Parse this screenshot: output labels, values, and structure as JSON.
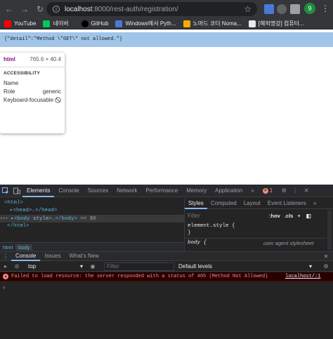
{
  "browser": {
    "url_host": "localhost",
    "url_rest": ":8000/rest-auth/registration/",
    "profile_initial": "9",
    "bookmarks": [
      "YouTube",
      "네이버",
      "GitHub",
      "Windows에서 Pyth...",
      "노마드 코더 Noma...",
      "[해외명강] 컴퓨터..."
    ]
  },
  "page": {
    "body_text": "{\"detail\":\"Method \\\"GET\\\" not allowed.\"}"
  },
  "tooltip": {
    "tag": "html",
    "size": "765.6 × 40.4",
    "heading": "ACCESSIBILITY",
    "rows": [
      {
        "label": "Name",
        "value": ""
      },
      {
        "label": "Role",
        "value": "generic"
      },
      {
        "label": "Keyboard-focusable",
        "value": ""
      }
    ]
  },
  "devtools": {
    "tabs": [
      "Elements",
      "Console",
      "Sources",
      "Network",
      "Performance",
      "Memory",
      "Application"
    ],
    "more": "»",
    "error_count": "1",
    "dom": {
      "html_open": "<html>",
      "head": "<head>…</head>",
      "body_prefix": "<body ",
      "body_attr": "style",
      "body_suffix": ">…</body>",
      "body_eq": " == $0",
      "html_close": "</html>",
      "expander": "•••"
    },
    "breadcrumbs": [
      "html",
      "body"
    ],
    "styles_tabs": [
      "Styles",
      "Computed",
      "Layout",
      "Event Listeners",
      "»"
    ],
    "styles_filter_placeholder": "Filter",
    "hov": ":hov",
    "cls": ".cls",
    "add": "+",
    "element_style": "element.style {",
    "close_brace": "}",
    "body_rule": "body {",
    "ua_label": "user agent stylesheet"
  },
  "drawer": {
    "tabs": [
      "Console",
      "Issues",
      "What's New"
    ],
    "context": "top",
    "filter_placeholder": "Filter",
    "levels": "Default levels",
    "error_message": "Failed to load resource: the server responded with a status of 405 (Method Not Allowed)",
    "error_source": "localhost/:1",
    "prompt": "›"
  }
}
